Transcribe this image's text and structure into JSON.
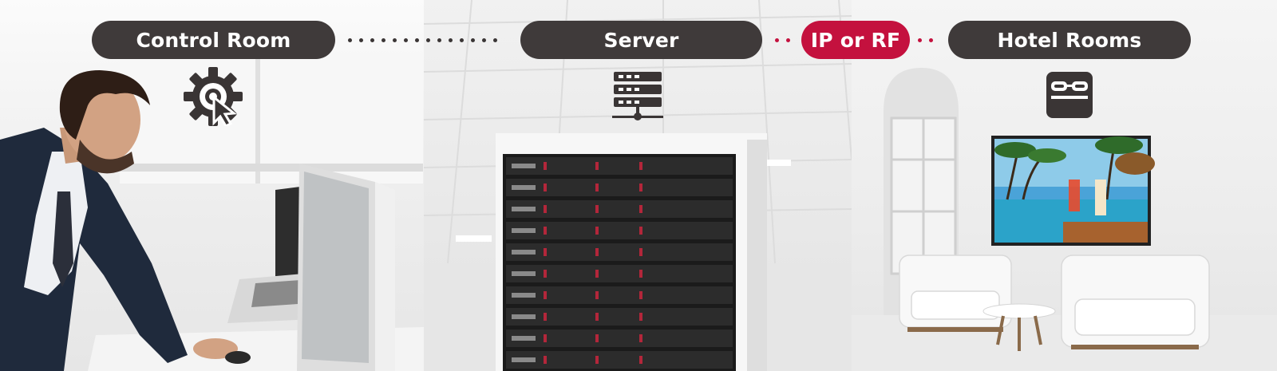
{
  "labels": {
    "control_room": "Control Room",
    "server": "Server",
    "connection": "IP or RF",
    "hotel_rooms": "Hotel Rooms"
  },
  "icons": {
    "control_room": "gear-cursor-icon",
    "server": "server-stack-icon",
    "hotel_rooms": "bed-icon"
  },
  "colors": {
    "pill_dark": "#3f3a3a",
    "pill_accent": "#c4113e"
  }
}
